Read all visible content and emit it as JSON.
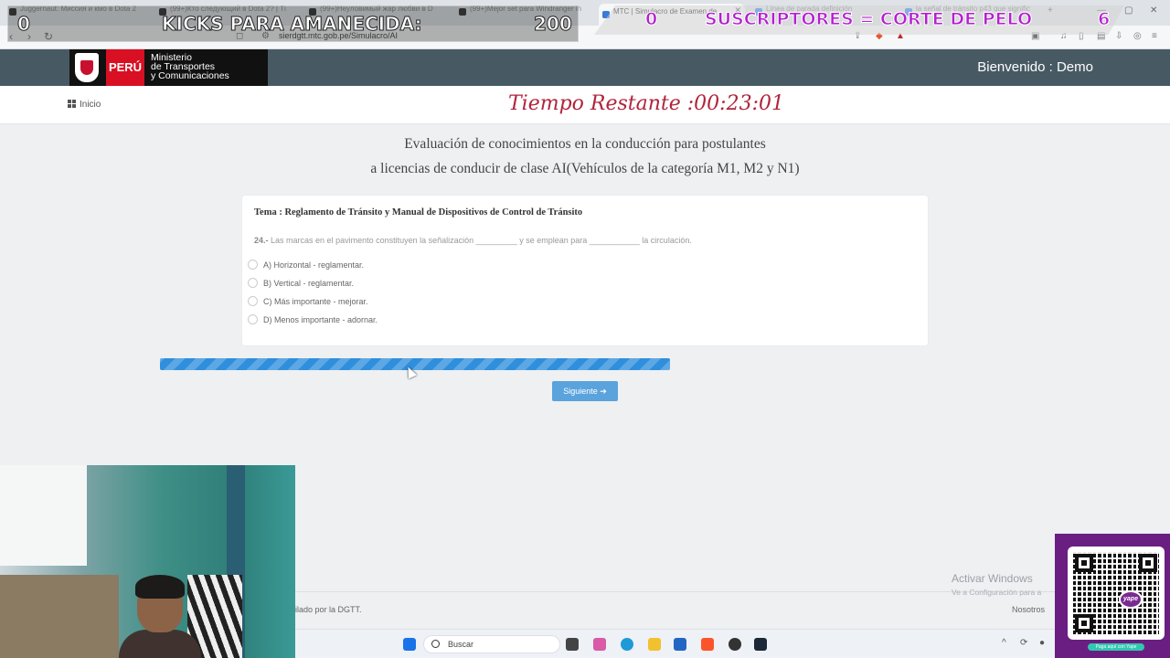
{
  "browser": {
    "tabs": [
      {
        "label": "Juggernaut: Миссия и кмо в Dota 2",
        "active": false
      },
      {
        "label": "(99+)Кто следующий в Dota 2? | Ті",
        "active": false
      },
      {
        "label": "(99+)Неуловимый жар любви в D",
        "active": false
      },
      {
        "label": "(99+)Mejor set para Windranger in",
        "active": false
      },
      {
        "label": "MTC | Simulacro de Examen de",
        "active": true
      },
      {
        "label": "Línea de parada definición",
        "active": false
      },
      {
        "label": "la señal de tránsito p43 que signific",
        "active": false
      }
    ],
    "url": "sierdgtt.mtc.gob.pe/Simulacro/AI"
  },
  "overlay": {
    "left_count": "0",
    "kicks_label": "KICKS PARA AMANECIDA:",
    "kicks_goal": "200",
    "right_count": "0",
    "subs_label": "SUSCRIPTORES = CORTE DE PELO",
    "subs_goal": "6"
  },
  "header": {
    "logo_country": "PERÚ",
    "logo_line1": "Ministerio",
    "logo_line2": "de Transportes",
    "logo_line3": "y Comunicaciones",
    "welcome": "Bienvenido : Demo"
  },
  "subheader": {
    "home_label": "Inicio",
    "timer_label": "Tiempo Restante :00:23:01"
  },
  "exam": {
    "title_line1": "Evaluación de conocimientos en la conducción para postulantes",
    "title_line2": "a licencias de conducir de clase AI(Vehículos de la categoría M1, M2 y N1)",
    "topic": "Tema : Reglamento de Tránsito y Manual de Dispositivos de Control de Tránsito",
    "question_number": "24.-",
    "question_text": "Las marcas en el pavimento constituyen la señalización _________ y se emplean para ___________ la circulación.",
    "options": [
      {
        "label": "A) Horizontal - reglamentar."
      },
      {
        "label": "B) Vertical - reglamentar."
      },
      {
        "label": "C) Más importante - mejorar."
      },
      {
        "label": "D) Menos importante - adornar."
      }
    ],
    "next_label": "Siguiente ➔"
  },
  "footer": {
    "left_text": "ilado por la DGTT.",
    "right_text": "Nosotros",
    "activate_title": "Activar Windows",
    "activate_sub": "Ve a Configuración para a"
  },
  "taskbar": {
    "search_label": "Buscar"
  },
  "qr": {
    "badge": "yape",
    "caption": "Paga aquí con Yape"
  },
  "colors": {
    "header_bg": "#475a64",
    "timer": "#b0243b",
    "progress": "#2f8fdc",
    "next_button": "#5aa3dd",
    "overlay_pink": "#b51fd0"
  }
}
